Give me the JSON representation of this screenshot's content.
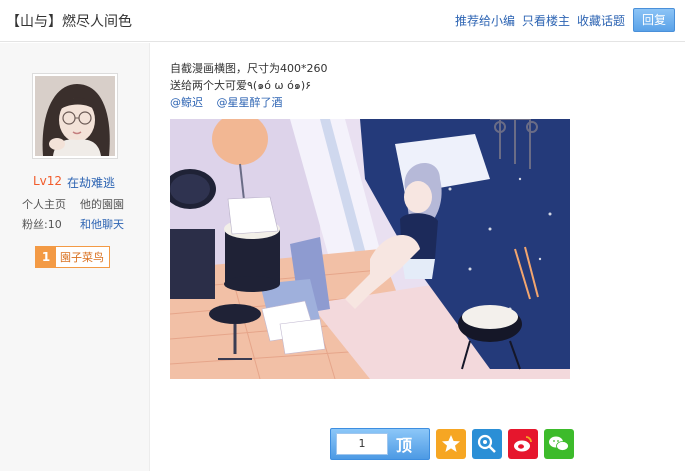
{
  "header": {
    "title": "【山与】燃尽人间色",
    "recommend": "推荐给小编",
    "only_op": "只看楼主",
    "favorite": "收藏话题",
    "reply": "回复"
  },
  "author": {
    "level": "Lv12",
    "name": "在劫难逃",
    "home": "个人主页",
    "garden": "他的園園",
    "fans": "粉丝:10",
    "chat": "和他聊天",
    "badge_num": "1",
    "badge_text": "園子菜鸟"
  },
  "post": {
    "line1": "自截漫画横图，尺寸为400*260",
    "line2": "送给两个大可爱٩(๑ó ω ó๑)۶",
    "mentions": [
      "@鲸迟",
      "@星星醉了酒"
    ]
  },
  "actions": {
    "ding_count": "1",
    "ding_label": "顶"
  },
  "colors": {
    "link": "#2d64b3",
    "level": "#f25c2c",
    "badge": "#f39a45",
    "primary_button": "#4d9ae4"
  },
  "icons": [
    "star-icon",
    "qzone-icon",
    "weibo-icon",
    "wechat-icon"
  ]
}
